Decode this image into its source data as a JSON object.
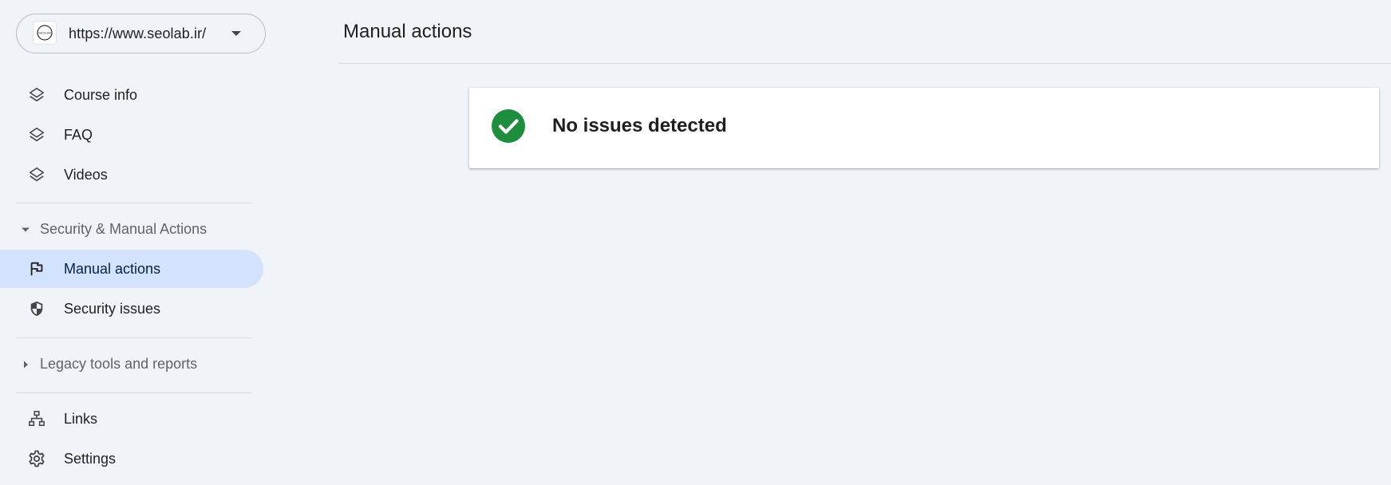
{
  "property": {
    "url": "https://www.seolab.ir/",
    "logo_text": "SEOLAB"
  },
  "sidebar": {
    "items_top": [
      {
        "label": "Course info",
        "icon": "layers-icon"
      },
      {
        "label": "FAQ",
        "icon": "layers-icon"
      },
      {
        "label": "Videos",
        "icon": "layers-icon"
      }
    ],
    "security_section": {
      "label": "Security & Manual Actions",
      "expanded": true,
      "items": [
        {
          "label": "Manual actions",
          "icon": "flag-icon",
          "active": true
        },
        {
          "label": "Security issues",
          "icon": "shield-icon",
          "active": false
        }
      ]
    },
    "legacy_section": {
      "label": "Legacy tools and reports",
      "expanded": false
    },
    "items_bottom": [
      {
        "label": "Links",
        "icon": "sitemap-icon"
      },
      {
        "label": "Settings",
        "icon": "gear-icon"
      }
    ]
  },
  "main": {
    "title": "Manual actions",
    "status": {
      "text": "No issues detected",
      "icon": "check-circle-icon",
      "color": "#1e8e3e"
    }
  },
  "colors": {
    "background": "#f0f4f9",
    "active_nav": "#d3e3fd",
    "success": "#1e8e3e"
  }
}
